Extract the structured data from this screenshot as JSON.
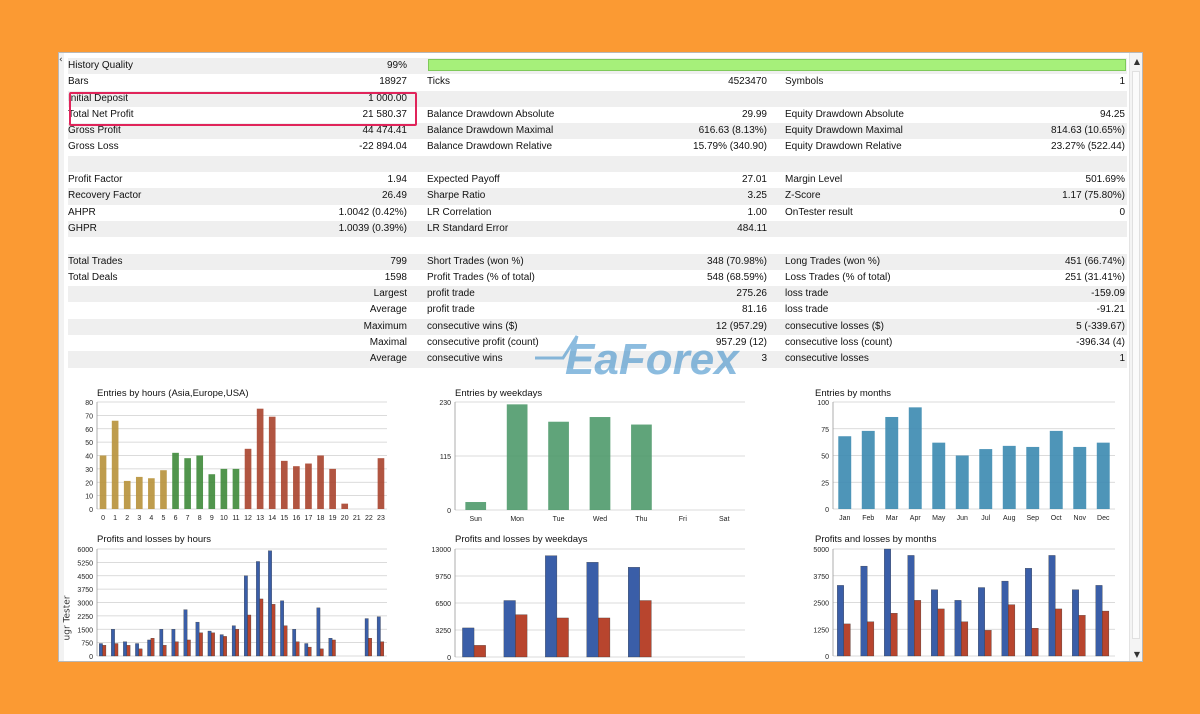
{
  "stats": {
    "rows": [
      {
        "l1": "History Quality",
        "v1": "99%",
        "quality_bar": true
      },
      {
        "l1": "Bars",
        "v1": "18927",
        "l2": "Ticks",
        "v2": "4523470",
        "l3": "Symbols",
        "v3": "1"
      },
      {
        "l1": "Initial Deposit",
        "v1": "1 000.00"
      },
      {
        "l1": "Total Net Profit",
        "v1": "21 580.37",
        "l2": "Balance Drawdown Absolute",
        "v2": "29.99",
        "l3": "Equity Drawdown Absolute",
        "v3": "94.25"
      },
      {
        "l1": "Gross Profit",
        "v1": "44 474.41",
        "l2": "Balance Drawdown Maximal",
        "v2": "616.63 (8.13%)",
        "l3": "Equity Drawdown Maximal",
        "v3": "814.63 (10.65%)"
      },
      {
        "l1": "Gross Loss",
        "v1": "-22 894.04",
        "l2": "Balance Drawdown Relative",
        "v2": "15.79% (340.90)",
        "l3": "Equity Drawdown Relative",
        "v3": "23.27% (522.44)"
      },
      {},
      {
        "l1": "Profit Factor",
        "v1": "1.94",
        "l2": "Expected Payoff",
        "v2": "27.01",
        "l3": "Margin Level",
        "v3": "501.69%"
      },
      {
        "l1": "Recovery Factor",
        "v1": "26.49",
        "l2": "Sharpe Ratio",
        "v2": "3.25",
        "l3": "Z-Score",
        "v3": "1.17 (75.80%)"
      },
      {
        "l1": "AHPR",
        "v1": "1.0042 (0.42%)",
        "l2": "LR Correlation",
        "v2": "1.00",
        "l3": "OnTester result",
        "v3": "0"
      },
      {
        "l1": "GHPR",
        "v1": "1.0039 (0.39%)",
        "l2": "LR Standard Error",
        "v2": "484.11"
      },
      {},
      {
        "l1": "Total Trades",
        "v1": "799",
        "l2": "Short Trades (won %)",
        "v2": "348 (70.98%)",
        "l3": "Long Trades (won %)",
        "v3": "451 (66.74%)"
      },
      {
        "l1": "Total Deals",
        "v1": "1598",
        "l2": "Profit Trades (% of total)",
        "v2": "548 (68.59%)",
        "l3": "Loss Trades (% of total)",
        "v3": "251 (31.41%)"
      },
      {
        "v1": "Largest",
        "l2": "profit trade",
        "v2": "275.26",
        "l3": "loss trade",
        "v3": "-159.09"
      },
      {
        "v1": "Average",
        "l2": "profit trade",
        "v2": "81.16",
        "l3": "loss trade",
        "v3": "-91.21"
      },
      {
        "v1": "Maximum",
        "l2": "consecutive wins ($)",
        "v2": "12 (957.29)",
        "l3": "consecutive losses ($)",
        "v3": "5 (-339.67)"
      },
      {
        "v1": "Maximal",
        "l2": "consecutive profit (count)",
        "v2": "957.29 (12)",
        "l3": "consecutive loss (count)",
        "v3": "-396.34 (4)"
      },
      {
        "v1": "Average",
        "l2": "consecutive wins",
        "v2": "3",
        "l3": "consecutive losses",
        "v3": "1"
      }
    ]
  },
  "watermark": {
    "text": "EaForex",
    "color": "#2f86c6"
  },
  "sidebar_text": "ugr Tester",
  "colors": {
    "quality_bar": "#a6f07a",
    "highlight": "#e0245a",
    "profit": "#3a5ea8",
    "loss": "#b8452e"
  },
  "chart_data": [
    {
      "type": "bar",
      "title": "Entries by hours (Asia,Europe,USA)",
      "categories": [
        "0",
        "1",
        "2",
        "3",
        "4",
        "5",
        "6",
        "7",
        "8",
        "9",
        "10",
        "11",
        "12",
        "13",
        "14",
        "15",
        "16",
        "17",
        "18",
        "19",
        "20",
        "21",
        "22",
        "23"
      ],
      "values": [
        40,
        66,
        21,
        24,
        23,
        29,
        42,
        38,
        40,
        26,
        30,
        30,
        45,
        75,
        69,
        36,
        32,
        34,
        40,
        30,
        4,
        0,
        0,
        38
      ],
      "ylim": [
        0,
        80
      ],
      "yticks": [
        "0",
        "10",
        "20",
        "30",
        "40",
        "50",
        "60",
        "70",
        "80"
      ],
      "segment_colors": [
        "#b7913a",
        "#3e8a3a",
        "#a8432c"
      ]
    },
    {
      "type": "bar",
      "title": "Entries by weekdays",
      "categories": [
        "Sun",
        "Mon",
        "Tue",
        "Wed",
        "Thu",
        "Fri",
        "Sat"
      ],
      "values": [
        17,
        225,
        188,
        198,
        182,
        0,
        0
      ],
      "ylim": [
        0,
        230
      ],
      "yticks": [
        "0",
        "115",
        "230"
      ],
      "color": "#4f9a6b"
    },
    {
      "type": "bar",
      "title": "Entries by months",
      "categories": [
        "Jan",
        "Feb",
        "Mar",
        "Apr",
        "May",
        "Jun",
        "Jul",
        "Aug",
        "Sep",
        "Oct",
        "Nov",
        "Dec"
      ],
      "values": [
        68,
        73,
        86,
        95,
        62,
        50,
        56,
        59,
        58,
        73,
        58,
        62
      ],
      "ylim": [
        0,
        100
      ],
      "yticks": [
        "0",
        "25",
        "50",
        "75",
        "100"
      ],
      "color": "#3b8ab0"
    },
    {
      "type": "bar",
      "title": "Profits and losses by hours",
      "categories": [
        "0",
        "1",
        "2",
        "3",
        "4",
        "5",
        "6",
        "7",
        "8",
        "9",
        "10",
        "11",
        "12",
        "13",
        "14",
        "15",
        "16",
        "17",
        "18",
        "19",
        "20",
        "21",
        "22",
        "23"
      ],
      "series": [
        {
          "name": "",
          "values": [
            700,
            1500,
            800,
            700,
            900,
            1500,
            1500,
            2600,
            1900,
            1400,
            1200,
            1700,
            4500,
            5300,
            5900,
            3100,
            1500,
            700,
            2700,
            1000,
            0,
            0,
            2100,
            2200
          ]
        },
        {
          "name": "",
          "values": [
            600,
            700,
            600,
            400,
            1000,
            600,
            800,
            900,
            1300,
            1300,
            1100,
            1500,
            2300,
            3200,
            2900,
            1700,
            800,
            500,
            400,
            900,
            0,
            0,
            1000,
            800
          ]
        }
      ],
      "ylim": [
        0,
        6000
      ],
      "yticks": [
        "0",
        "750",
        "1500",
        "2250",
        "3000",
        "3750",
        "4500",
        "5250",
        "6000"
      ]
    },
    {
      "type": "bar",
      "title": "Profits and losses by weekdays",
      "categories": [
        "Sun",
        "Mon",
        "Tue",
        "Wed",
        "Thu",
        "Fri",
        "Sat"
      ],
      "series": [
        {
          "name": "",
          "values": [
            3500,
            6800,
            12200,
            11400,
            10800,
            0,
            0
          ]
        },
        {
          "name": "",
          "values": [
            1400,
            5100,
            4700,
            4700,
            6800,
            0,
            0
          ]
        }
      ],
      "ylim": [
        0,
        13000
      ],
      "yticks": [
        "0",
        "3250",
        "6500",
        "9750",
        "13000"
      ]
    },
    {
      "type": "bar",
      "title": "Profits and losses by months",
      "categories": [
        "Jan",
        "Feb",
        "Mar",
        "Apr",
        "May",
        "Jun",
        "Jul",
        "Aug",
        "Sep",
        "Oct",
        "Nov",
        "Dec"
      ],
      "series": [
        {
          "name": "",
          "values": [
            3300,
            4200,
            5000,
            4700,
            3100,
            2600,
            3200,
            3500,
            4100,
            4700,
            3100,
            3300
          ]
        },
        {
          "name": "",
          "values": [
            1500,
            1600,
            2000,
            2600,
            2200,
            1600,
            1200,
            2400,
            1300,
            2200,
            1900,
            2100
          ]
        }
      ],
      "ylim": [
        0,
        5000
      ],
      "yticks": [
        "0",
        "1250",
        "2500",
        "3750",
        "5000"
      ]
    }
  ]
}
